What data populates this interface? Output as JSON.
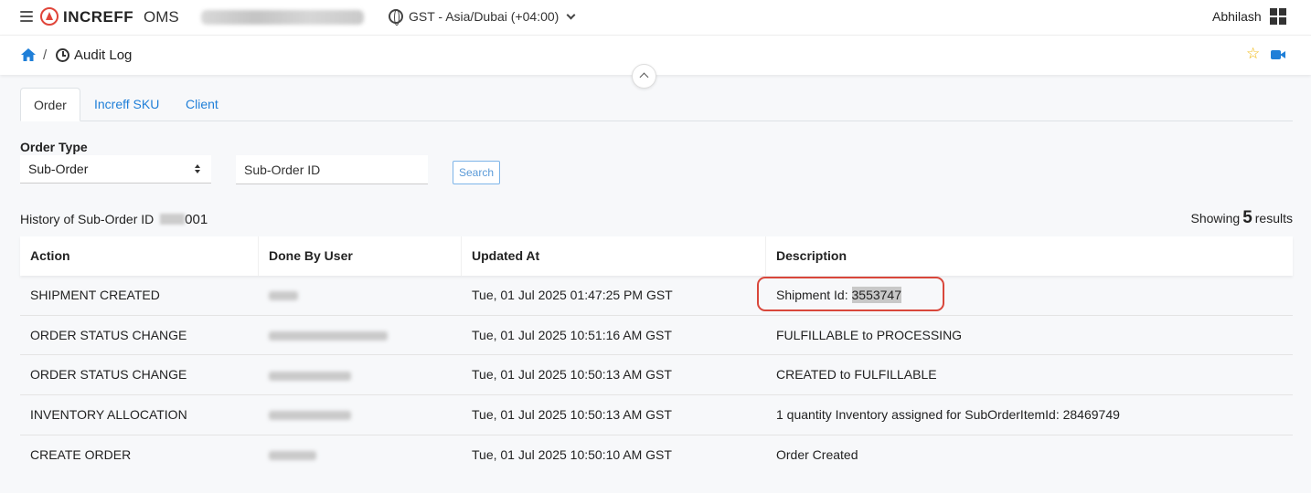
{
  "topbar": {
    "app_name": "INCREFF",
    "app_suffix": "OMS",
    "timezone": "GST - Asia/Dubai (+04:00)",
    "user_name": "Abhilash"
  },
  "breadcrumb": {
    "separator": "/",
    "title": "Audit Log"
  },
  "tabs": [
    {
      "label": "Order",
      "active": true
    },
    {
      "label": "Increff SKU",
      "active": false
    },
    {
      "label": "Client",
      "active": false
    }
  ],
  "filters": {
    "order_type_label": "Order Type",
    "order_type_value": "Sub-Order",
    "id_placeholder": "Sub-Order ID",
    "search_label": "Search"
  },
  "history": {
    "title_prefix": "History of Sub-Order ID",
    "id_visible_suffix": "001",
    "showing_prefix": "Showing",
    "count": "5",
    "showing_suffix": "results"
  },
  "table": {
    "columns": [
      "Action",
      "Done By User",
      "Updated At",
      "Description"
    ],
    "rows": [
      {
        "action": "SHIPMENT CREATED",
        "updated_at": "Tue, 01 Jul 2025 01:47:25 PM GST",
        "description_prefix": "Shipment Id: ",
        "description_value": "3553747"
      },
      {
        "action": "ORDER STATUS CHANGE",
        "updated_at": "Tue, 01 Jul 2025 10:51:16 AM GST",
        "description": "FULFILLABLE to PROCESSING"
      },
      {
        "action": "ORDER STATUS CHANGE",
        "updated_at": "Tue, 01 Jul 2025 10:50:13 AM GST",
        "description": "CREATED to FULFILLABLE"
      },
      {
        "action": "INVENTORY ALLOCATION",
        "updated_at": "Tue, 01 Jul 2025 10:50:13 AM GST",
        "description": "1 quantity Inventory assigned for SubOrderItemId: 28469749"
      },
      {
        "action": "CREATE ORDER",
        "updated_at": "Tue, 01 Jul 2025 10:50:10 AM GST",
        "description": "Order Created"
      }
    ]
  },
  "colors": {
    "accent": "#1f7fd8",
    "logo": "#e0453a",
    "highlight": "#d9473b",
    "star": "#f0b400"
  }
}
